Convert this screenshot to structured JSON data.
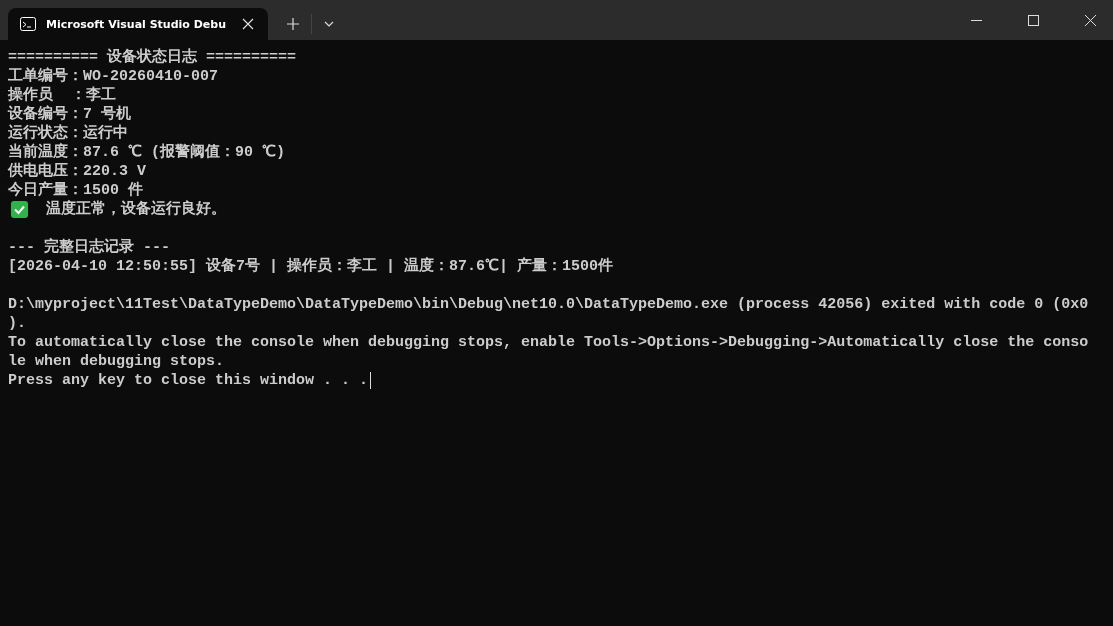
{
  "tab": {
    "title": "Microsoft Visual Studio Debu"
  },
  "console": {
    "lines": [
      {
        "kind": "text",
        "text": "========== 设备状态日志 =========="
      },
      {
        "kind": "text",
        "text": "工单编号：WO-20260410-007"
      },
      {
        "kind": "text",
        "text": "操作员  ：李工"
      },
      {
        "kind": "text",
        "text": "设备编号：7 号机"
      },
      {
        "kind": "text",
        "text": "运行状态：运行中"
      },
      {
        "kind": "text",
        "text": "当前温度：87.6 ℃ (报警阈值：90 ℃)"
      },
      {
        "kind": "text",
        "text": "供电电压：220.3 V"
      },
      {
        "kind": "text",
        "text": "今日产量：1500 件"
      },
      {
        "kind": "check",
        "text": "温度正常，设备运行良好。"
      },
      {
        "kind": "blank"
      },
      {
        "kind": "text",
        "text": "--- 完整日志记录 ---"
      },
      {
        "kind": "text",
        "text": "[2026-04-10 12:50:55] 设备7号 | 操作员：李工 | 温度：87.6℃| 产量：1500件"
      },
      {
        "kind": "blank"
      },
      {
        "kind": "text",
        "text": "D:\\myproject\\11Test\\DataTypeDemo\\DataTypeDemo\\bin\\Debug\\net10.0\\DataTypeDemo.exe (process 42056) exited with code 0 (0x0"
      },
      {
        "kind": "text",
        "text": ")."
      },
      {
        "kind": "text",
        "text": "To automatically close the console when debugging stops, enable Tools->Options->Debugging->Automatically close the conso"
      },
      {
        "kind": "text",
        "text": "le when debugging stops."
      },
      {
        "kind": "prompt",
        "text": "Press any key to close this window . . ."
      }
    ]
  }
}
